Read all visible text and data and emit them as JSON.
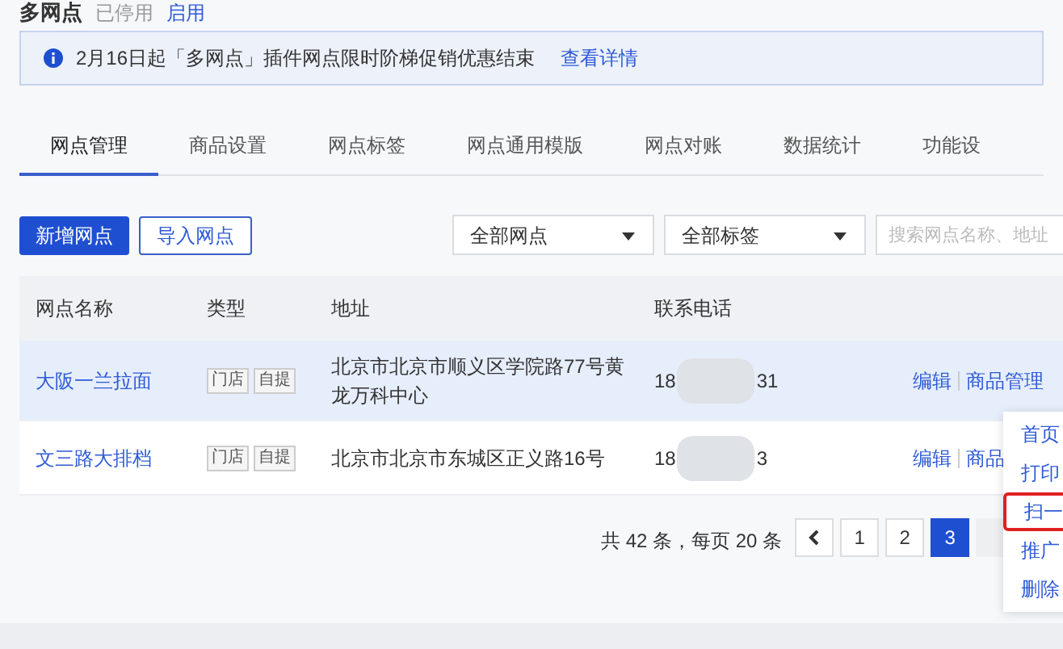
{
  "header": {
    "title": "多网点",
    "status": "已停用",
    "action": "启用"
  },
  "notice": {
    "text": "2月16日起「多网点」插件网点限时阶梯促销优惠结束",
    "link": "查看详情"
  },
  "tabs": [
    {
      "label": "网点管理",
      "selected": true
    },
    {
      "label": "商品设置",
      "selected": false
    },
    {
      "label": "网点标签",
      "selected": false
    },
    {
      "label": "网点通用模版",
      "selected": false
    },
    {
      "label": "网点对账",
      "selected": false
    },
    {
      "label": "数据统计",
      "selected": false
    },
    {
      "label": "功能设",
      "selected": false
    }
  ],
  "toolbar": {
    "buttons": [
      {
        "label": "新增网点",
        "kind": "primary"
      },
      {
        "label": "导入网点",
        "kind": "outline"
      }
    ],
    "filters": [
      "全部网点",
      "全部标签"
    ],
    "search": {
      "placeholder": "搜索网点名称、地址"
    }
  },
  "table": {
    "columns": [
      "网点名称",
      "类型",
      "地址",
      "联系电话"
    ],
    "rows": [
      {
        "name": "大阪一兰拉面",
        "tags": [
          "门店",
          "自提"
        ],
        "address": "北京市北京市顺义区学院路77号黄龙万科中心",
        "phone_start": "18",
        "phone_end": "31",
        "actions": [
          "编辑",
          "商品管理"
        ],
        "selected": true
      },
      {
        "name": "文三路大排档",
        "tags": [
          "门店",
          "自提"
        ],
        "address": "北京市北京市东城区正义路16号",
        "phone_start": "18",
        "phone_end": "3",
        "actions": [
          "编辑",
          "商品"
        ],
        "selected": false
      }
    ]
  },
  "pagination": {
    "summary": "共 42 条，每页 20 条",
    "pages": [
      {
        "label": "1",
        "selected": false
      },
      {
        "label": "2",
        "selected": false
      },
      {
        "label": "3",
        "selected": true
      }
    ]
  },
  "menu": {
    "items": [
      {
        "label": "首页",
        "highlighted": false
      },
      {
        "label": "打印",
        "highlighted": false
      },
      {
        "label": "扫一",
        "highlighted": true
      },
      {
        "label": "推广",
        "highlighted": false
      },
      {
        "label": "删除",
        "highlighted": false
      }
    ]
  }
}
